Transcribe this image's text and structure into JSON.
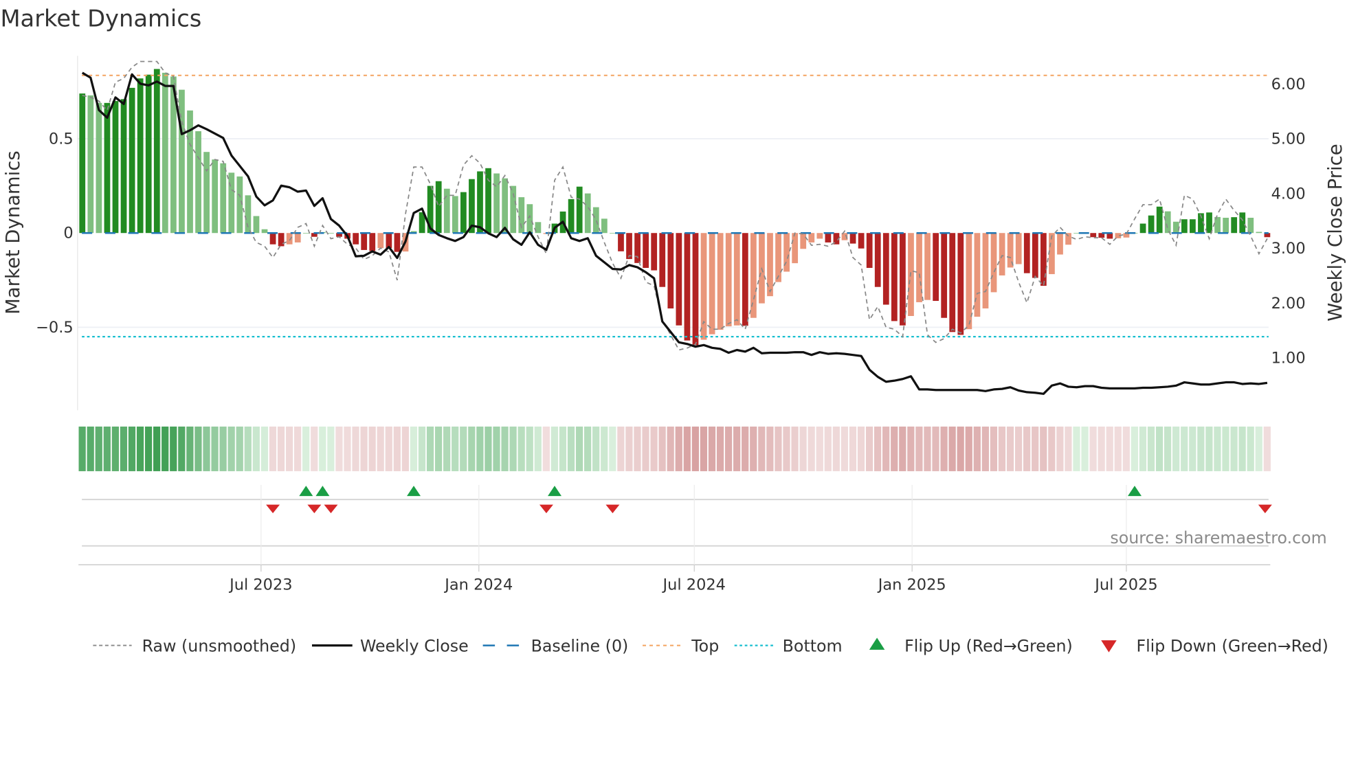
{
  "title": "Market Dynamics",
  "source": "source: sharemaestro.com",
  "colors": {
    "up_strong": "#228b22",
    "up_weak": "#7fbf7f",
    "down_strong": "#b22222",
    "down_weak": "#e9967a",
    "close": "#111111",
    "raw": "#888888",
    "baseline": "#1f77b4",
    "top": "#f4a460",
    "bottom": "#17becf",
    "flip_up": "#1a9e45",
    "flip_down": "#d62728"
  },
  "legend": [
    {
      "key": "raw",
      "label": "Raw (unsmoothed)"
    },
    {
      "key": "close",
      "label": "Weekly Close"
    },
    {
      "key": "baseline",
      "label": "Baseline (0)"
    },
    {
      "key": "top",
      "label": "Top"
    },
    {
      "key": "bottom",
      "label": "Bottom"
    },
    {
      "key": "flip_up",
      "label": "Flip Up (Red→Green)"
    },
    {
      "key": "flip_down",
      "label": "Flip Down (Green→Red)"
    }
  ],
  "chart_data": {
    "type": "bar",
    "title": "Market Dynamics",
    "xlabel": "",
    "ylabel": "Market Dynamics",
    "y2label": "Weekly Close Price",
    "ylim": [
      -0.94,
      0.94
    ],
    "y2lim": [
      0.03,
      6.5
    ],
    "yticks": [
      {
        "v": 0.5,
        "label": "0.5"
      },
      {
        "v": 0,
        "label": "0"
      },
      {
        "v": -0.5,
        "label": "−0.5"
      }
    ],
    "y2ticks": [
      {
        "v": 6,
        "label": "6.00"
      },
      {
        "v": 5,
        "label": "5.00"
      },
      {
        "v": 4,
        "label": "4.00"
      },
      {
        "v": 3,
        "label": "3.00"
      },
      {
        "v": 2,
        "label": "2.00"
      },
      {
        "v": 1,
        "label": "1.00"
      }
    ],
    "xticks": [
      {
        "date": "2023-07-01",
        "label": "Jul 2023"
      },
      {
        "date": "2024-01-01",
        "label": "Jan 2024"
      },
      {
        "date": "2024-07-01",
        "label": "Jul 2024"
      },
      {
        "date": "2025-01-01",
        "label": "Jan 2025"
      },
      {
        "date": "2025-07-01",
        "label": "Jul 2025"
      }
    ],
    "start_date": "2023-01-31",
    "frequency": "weekly",
    "top_level": 0.836,
    "bottom_level": -0.55,
    "baseline": 0,
    "dynamics": [
      0.74,
      0.73,
      0.69,
      0.69,
      0.7,
      0.71,
      0.77,
      0.82,
      0.84,
      0.87,
      0.85,
      0.83,
      0.76,
      0.65,
      0.54,
      0.43,
      0.39,
      0.37,
      0.32,
      0.3,
      0.2,
      0.09,
      0.02,
      -0.06,
      -0.07,
      -0.06,
      -0.05,
      0.0,
      -0.02,
      0.005,
      0.0,
      -0.02,
      -0.03,
      -0.06,
      -0.09,
      -0.095,
      -0.08,
      -0.08,
      -0.1,
      -0.098,
      0.01,
      0.11,
      0.25,
      0.275,
      0.235,
      0.196,
      0.217,
      0.286,
      0.327,
      0.344,
      0.316,
      0.29,
      0.25,
      0.19,
      0.153,
      0.058,
      -0.005,
      0.05,
      0.114,
      0.18,
      0.246,
      0.21,
      0.137,
      0.076,
      0.0,
      -0.097,
      -0.138,
      -0.159,
      -0.185,
      -0.198,
      -0.286,
      -0.4,
      -0.49,
      -0.57,
      -0.595,
      -0.566,
      -0.537,
      -0.513,
      -0.495,
      -0.49,
      -0.492,
      -0.45,
      -0.373,
      -0.335,
      -0.26,
      -0.205,
      -0.16,
      -0.084,
      -0.05,
      -0.03,
      -0.05,
      -0.06,
      -0.038,
      -0.056,
      -0.082,
      -0.185,
      -0.286,
      -0.38,
      -0.467,
      -0.49,
      -0.44,
      -0.367,
      -0.355,
      -0.36,
      -0.45,
      -0.525,
      -0.54,
      -0.51,
      -0.444,
      -0.4,
      -0.314,
      -0.225,
      -0.183,
      -0.165,
      -0.213,
      -0.238,
      -0.28,
      -0.218,
      -0.114,
      -0.062,
      0.0,
      0.0,
      -0.022,
      -0.025,
      -0.03,
      -0.028,
      -0.024,
      0.0,
      0.05,
      0.093,
      0.14,
      0.115,
      0.06,
      0.073,
      0.073,
      0.105,
      0.109,
      0.085,
      0.081,
      0.084,
      0.109,
      0.081,
      0.006,
      -0.022
    ],
    "raw": [
      0.73,
      0.72,
      0.7,
      0.65,
      0.8,
      0.82,
      0.88,
      0.91,
      0.91,
      0.91,
      0.85,
      0.83,
      0.59,
      0.47,
      0.4,
      0.33,
      0.39,
      0.38,
      0.23,
      0.2,
      0.03,
      -0.05,
      -0.07,
      -0.13,
      -0.06,
      -0.04,
      0.03,
      0.05,
      -0.07,
      0.04,
      -0.03,
      -0.02,
      -0.06,
      -0.08,
      -0.14,
      -0.12,
      -0.08,
      -0.1,
      -0.25,
      0.1,
      0.35,
      0.35,
      0.26,
      0.14,
      0.2,
      0.2,
      0.36,
      0.41,
      0.37,
      0.28,
      0.245,
      0.305,
      0.21,
      0.03,
      0.09,
      -0.02,
      -0.11,
      0.28,
      0.35,
      0.19,
      0.18,
      0.14,
      0.07,
      -0.05,
      -0.16,
      -0.24,
      -0.12,
      -0.125,
      -0.26,
      -0.28,
      -0.46,
      -0.54,
      -0.62,
      -0.61,
      -0.59,
      -0.47,
      -0.51,
      -0.51,
      -0.48,
      -0.46,
      -0.51,
      -0.355,
      -0.19,
      -0.31,
      -0.23,
      -0.15,
      0.0,
      -0.005,
      -0.065,
      -0.06,
      -0.07,
      -0.046,
      0.01,
      -0.13,
      -0.17,
      -0.46,
      -0.39,
      -0.5,
      -0.51,
      -0.55,
      -0.2,
      -0.21,
      -0.54,
      -0.58,
      -0.56,
      -0.51,
      -0.53,
      -0.49,
      -0.32,
      -0.31,
      -0.21,
      -0.12,
      -0.13,
      -0.26,
      -0.37,
      -0.23,
      -0.28,
      -0.016,
      0.03,
      -0.016,
      -0.034,
      -0.02,
      -0.025,
      -0.025,
      -0.06,
      -0.016,
      -0.005,
      0.075,
      0.15,
      0.15,
      0.18,
      0.02,
      -0.065,
      0.2,
      0.18,
      0.09,
      -0.03,
      0.1,
      0.18,
      0.12,
      0.07,
      -0.016,
      -0.11,
      -0.03
    ],
    "close": [
      6.19,
      6.1,
      5.51,
      5.37,
      5.74,
      5.62,
      6.16,
      5.99,
      5.96,
      6.03,
      5.95,
      5.95,
      5.07,
      5.14,
      5.23,
      5.16,
      5.08,
      5.0,
      4.68,
      4.49,
      4.3,
      3.93,
      3.77,
      3.86,
      4.13,
      4.1,
      4.02,
      4.04,
      3.76,
      3.9,
      3.52,
      3.4,
      3.21,
      2.84,
      2.85,
      2.93,
      2.87,
      3.01,
      2.81,
      3.11,
      3.63,
      3.71,
      3.35,
      3.23,
      3.17,
      3.12,
      3.19,
      3.4,
      3.37,
      3.26,
      3.19,
      3.36,
      3.15,
      3.05,
      3.28,
      3.05,
      2.96,
      3.36,
      3.47,
      3.17,
      3.12,
      3.17,
      2.85,
      2.73,
      2.61,
      2.6,
      2.68,
      2.64,
      2.55,
      2.44,
      1.65,
      1.46,
      1.27,
      1.24,
      1.19,
      1.22,
      1.17,
      1.15,
      1.08,
      1.13,
      1.1,
      1.17,
      1.07,
      1.08,
      1.08,
      1.08,
      1.09,
      1.09,
      1.04,
      1.09,
      1.06,
      1.07,
      1.06,
      1.04,
      1.02,
      0.77,
      0.64,
      0.55,
      0.57,
      0.6,
      0.65,
      0.41,
      0.41,
      0.4,
      0.4,
      0.4,
      0.4,
      0.4,
      0.4,
      0.38,
      0.41,
      0.42,
      0.45,
      0.39,
      0.36,
      0.35,
      0.33,
      0.48,
      0.52,
      0.46,
      0.45,
      0.47,
      0.47,
      0.44,
      0.43,
      0.43,
      0.43,
      0.43,
      0.44,
      0.44,
      0.45,
      0.46,
      0.48,
      0.54,
      0.52,
      0.5,
      0.5,
      0.52,
      0.54,
      0.54,
      0.51,
      0.52,
      0.51,
      0.53
    ],
    "flips_up": [
      "2023-08-08",
      "2023-08-22",
      "2023-11-07",
      "2024-03-05",
      "2025-07-08"
    ],
    "flips_down": [
      "2023-07-11",
      "2023-08-15",
      "2023-08-29",
      "2024-02-27",
      "2024-04-23",
      "2025-10-28"
    ],
    "legend_position": "bottom",
    "grid": true
  }
}
